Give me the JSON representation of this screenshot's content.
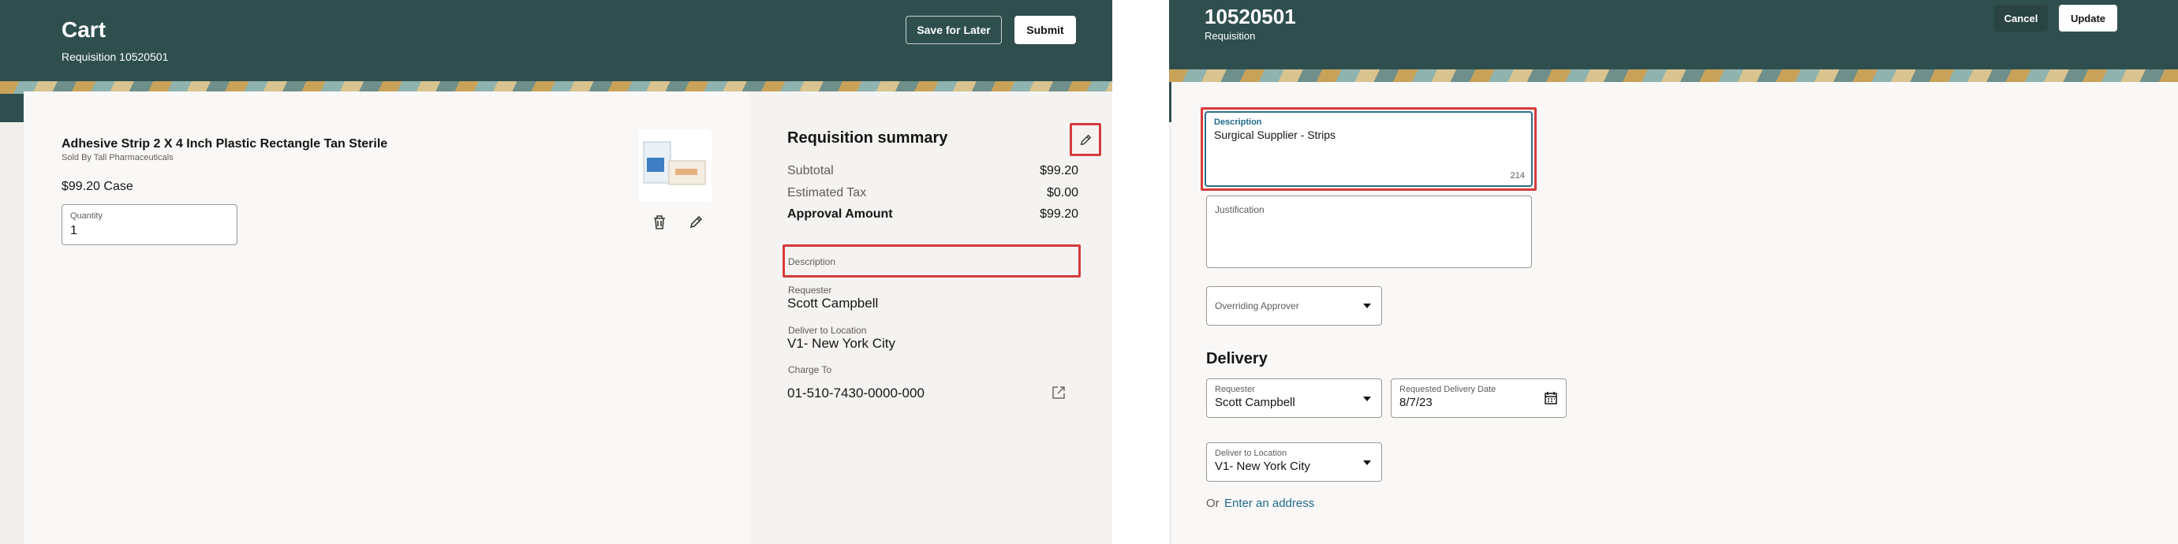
{
  "cart": {
    "title": "Cart",
    "subtitle": "Requisition 10520501",
    "save_later_label": "Save for Later",
    "submit_label": "Submit",
    "item": {
      "name": "Adhesive Strip 2 X 4 Inch Plastic Rectangle Tan Sterile",
      "seller": "Sold By Tall Pharmaceuticals",
      "price": "$99.20 Case",
      "quantity_label": "Quantity",
      "quantity_value": "1"
    },
    "summary": {
      "title": "Requisition summary",
      "subtotal_label": "Subtotal",
      "subtotal_value": "$99.20",
      "tax_label": "Estimated Tax",
      "tax_value": "$0.00",
      "approval_label": "Approval Amount",
      "approval_value": "$99.20",
      "description_label": "Description",
      "requester_label": "Requester",
      "requester_value": "Scott Campbell",
      "deliver_label": "Deliver to Location",
      "deliver_value": "V1- New York City",
      "charge_label": "Charge To",
      "charge_value": "01-510-7430-0000-000"
    }
  },
  "requisition": {
    "title": "10520501",
    "subtitle": "Requisition",
    "cancel_label": "Cancel",
    "update_label": "Update",
    "description_label": "Description",
    "description_value": "Surgical Supplier - Strips",
    "description_count": "214",
    "justification_label": "Justification",
    "overriding_label": "Overriding Approver",
    "delivery_heading": "Delivery",
    "requester_label": "Requester",
    "requester_value": "Scott Campbell",
    "date_label": "Requested Delivery Date",
    "date_value": "8/7/23",
    "deliver_label": "Deliver to Location",
    "deliver_value": "V1- New York City",
    "or_label": "Or",
    "enter_address_label": "Enter an address"
  },
  "colors": {
    "header": "#2f4f4f",
    "highlight": "#d63b3b",
    "link": "#1f6a8a"
  },
  "icons": [
    "trash-icon",
    "pencil-icon",
    "external-link-icon",
    "chevron-down-icon",
    "calendar-icon"
  ]
}
